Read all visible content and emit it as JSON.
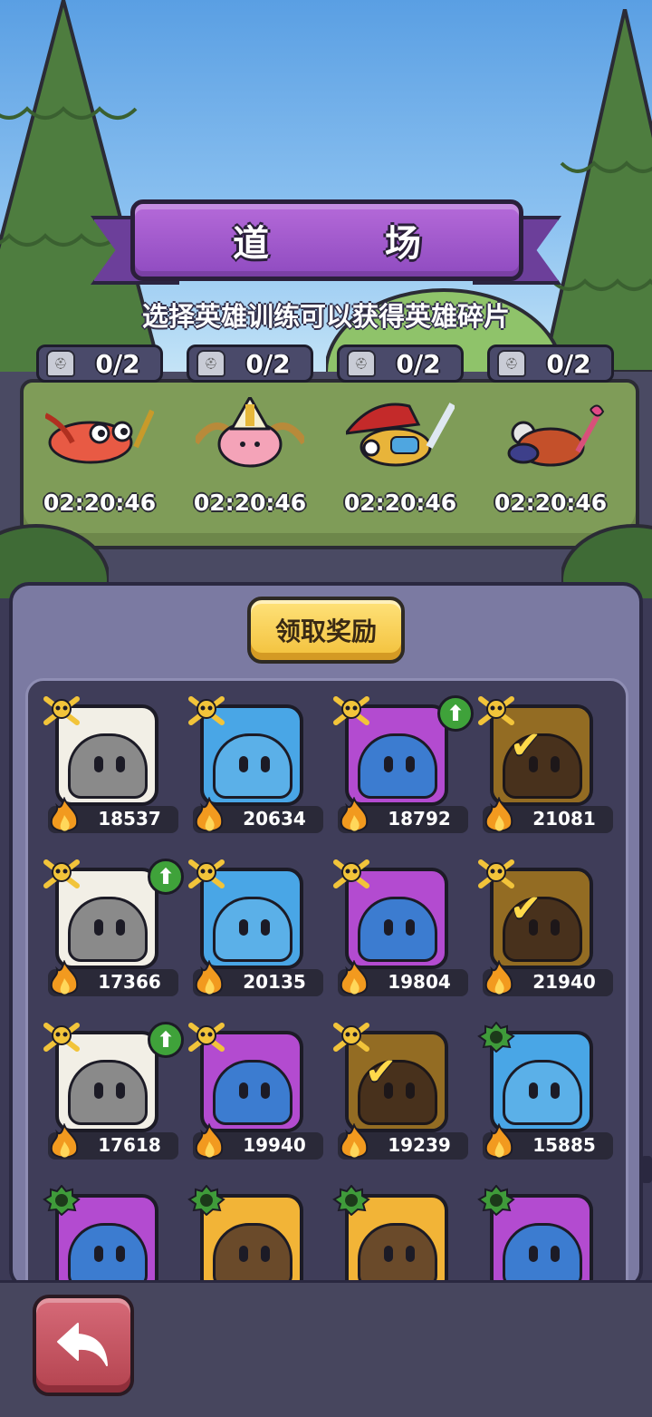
{
  "header": {
    "title": "道　场",
    "subtitle": "选择英雄训练可以获得英雄碎片"
  },
  "training_slots": [
    {
      "count": "0/2",
      "timer": "02:20:46",
      "hero": "rooster-knight"
    },
    {
      "count": "0/2",
      "timer": "02:20:46",
      "hero": "winged-priest"
    },
    {
      "count": "0/2",
      "timer": "02:20:46",
      "hero": "red-swordsman"
    },
    {
      "count": "0/2",
      "timer": "02:20:46",
      "hero": "bomber"
    }
  ],
  "claim_button": {
    "label": "领取奖励"
  },
  "heroes": [
    {
      "power": "18537",
      "color": "white",
      "rank": "gold-skull",
      "upgrade": false,
      "training": false
    },
    {
      "power": "20634",
      "color": "blue",
      "rank": "gold-skull",
      "upgrade": false,
      "training": false
    },
    {
      "power": "18792",
      "color": "purple",
      "rank": "gold-skull",
      "upgrade": true,
      "training": false
    },
    {
      "power": "21081",
      "color": "gold",
      "rank": "gold-skull",
      "upgrade": false,
      "training": true
    },
    {
      "power": "17366",
      "color": "white",
      "rank": "gold-skull",
      "upgrade": true,
      "training": false
    },
    {
      "power": "20135",
      "color": "blue",
      "rank": "gold-skull",
      "upgrade": false,
      "training": false
    },
    {
      "power": "19804",
      "color": "purple",
      "rank": "gold-skull",
      "upgrade": false,
      "training": false
    },
    {
      "power": "21940",
      "color": "gold",
      "rank": "gold-skull",
      "upgrade": false,
      "training": true
    },
    {
      "power": "17618",
      "color": "white",
      "rank": "gold-skull",
      "upgrade": true,
      "training": false
    },
    {
      "power": "19940",
      "color": "purple",
      "rank": "gold-skull",
      "upgrade": false,
      "training": false
    },
    {
      "power": "19239",
      "color": "gold",
      "rank": "gold-skull",
      "upgrade": false,
      "training": true
    },
    {
      "power": "15885",
      "color": "blue",
      "rank": "green-skull",
      "upgrade": false,
      "training": false
    },
    {
      "power": "",
      "color": "purple",
      "rank": "green-skull",
      "upgrade": false,
      "training": false
    },
    {
      "power": "",
      "color": "gold",
      "rank": "green-skull",
      "upgrade": false,
      "training": false
    },
    {
      "power": "",
      "color": "gold",
      "rank": "green-skull",
      "upgrade": false,
      "training": false
    },
    {
      "power": "",
      "color": "purple",
      "rank": "green-skull",
      "upgrade": false,
      "training": false
    }
  ],
  "back_button": {
    "icon": "back-arrow-icon"
  },
  "colors": {
    "banner": "#9b55c8",
    "claim": "#f5c842",
    "back": "#c4505c",
    "panel": "#7b7aa2"
  }
}
